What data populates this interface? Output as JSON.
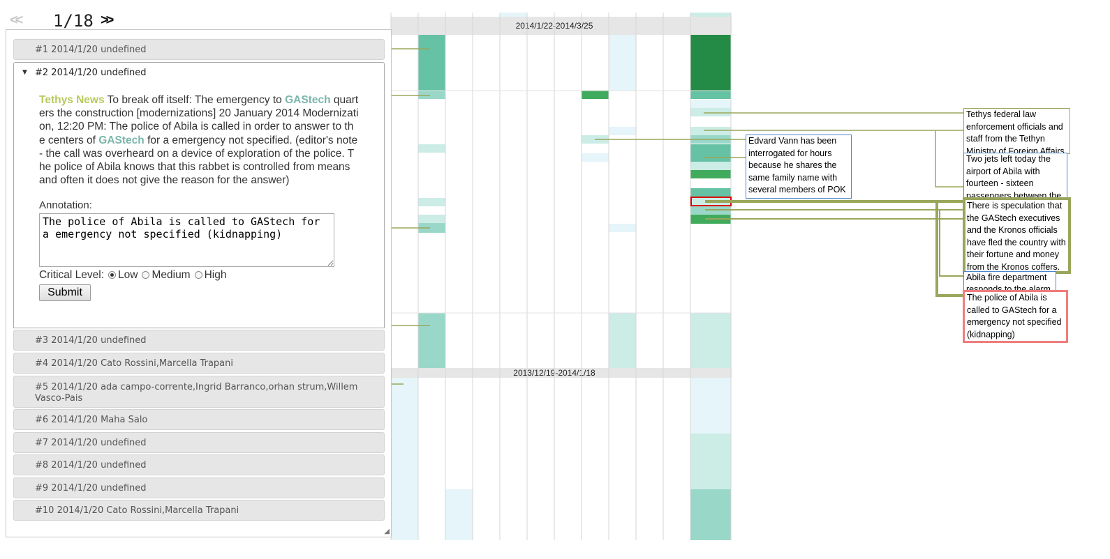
{
  "pager": {
    "prev_label": "<<",
    "page": "1/18",
    "next_label": ">>"
  },
  "accordion": {
    "items": [
      {
        "label": "#1 2014/1/20 undefined"
      },
      {
        "label": "#2 2014/1/20 undefined"
      },
      {
        "label": "#3 2014/1/20 undefined"
      },
      {
        "label": "#4 2014/1/20 Cato Rossini,Marcella Trapani"
      },
      {
        "label": "#5 2014/1/20 ada campo-corrente,Ingrid Barranco,orhan strum,Willem Vasco-Pais"
      },
      {
        "label": "#6 2014/1/20 Maha Salo"
      },
      {
        "label": "#7 2014/1/20 undefined"
      },
      {
        "label": "#8 2014/1/20 undefined"
      },
      {
        "label": "#9 2014/1/20 undefined"
      },
      {
        "label": "#10 2014/1/20 Cato Rossini,Marcella Trapani"
      }
    ],
    "expanded": {
      "source": "Tethys News",
      "parts": [
        " To break off itself: The emergency to ",
        "GAStech",
        " quarters the construction [modernizations] 20 January 2014 Modernization, 12:20 PM: The police of Abila is called in order to answer to the centers of ",
        "GAStech",
        " for a emergency not specified. (editor's note - the call was overheard on a device of exploration of the police. The police of Abila knows that this rabbet is controlled from means and often it does not give the reason for the answer)"
      ],
      "annotation_label": "Annotation:",
      "annotation_value": "The police of Abila is called to GAStech for a emergency not specified (kidnapping)",
      "critical_label": "Critical Level:",
      "critical_options": [
        "Low",
        "Medium",
        "High"
      ],
      "critical_selected": "Low",
      "submit_label": "Submit"
    }
  },
  "heatmap": {
    "range_top": "2014/1/22-2014/3/25",
    "range_bottom": "2013/12/19-2014/1/18",
    "colors": {
      "dark": "#238b45",
      "mid": "#41ab5d",
      "teal": "#66c2a4",
      "light": "#99d8c9",
      "pale": "#ccece6",
      "ice": "#e5f5f9"
    }
  },
  "notes": [
    {
      "text": "Edvard Vann has been interrogated for hours because he shares the same family name with several members of POK"
    },
    {
      "text": "Tethys federal law enforcement officials and staff from the Tethyn Ministry of Foreign Affairs"
    },
    {
      "text": "Two jets left today the airport of Abila with fourteen - sixteen passengers between the"
    },
    {
      "text": "There is speculation that the GAStech executives and the Kronos officials have fled the country with their fortune and money from the Kronos coffers."
    },
    {
      "text": "Abila fire department responds to the alarm"
    },
    {
      "text": "The police of Abila is called to GAStech for a emergency not specified (kidnapping)"
    }
  ]
}
